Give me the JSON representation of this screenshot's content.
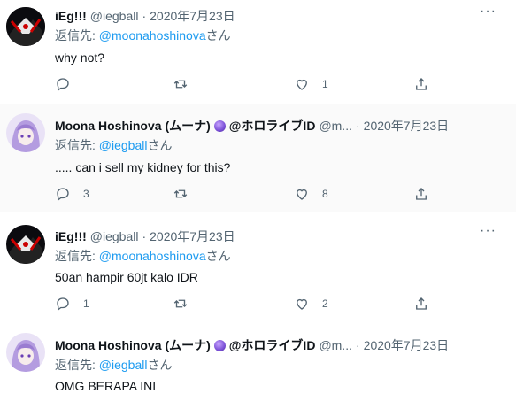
{
  "tweets": [
    {
      "name": "iEg!!!",
      "handle": "@iegball",
      "dot": "·",
      "date": "2020年7月23日",
      "reply_prefix": "返信先: ",
      "reply_to": "@moonahoshinova",
      "reply_suffix": "さん",
      "text": "why not?",
      "reply_count": "",
      "retweet_count": "",
      "like_count": "1"
    },
    {
      "name": "Moona Hoshinova (ムーナ)",
      "name_suffix": "@ホロライブID",
      "handle": "@m...",
      "dot": "·",
      "date": "2020年7月23日",
      "reply_prefix": "返信先: ",
      "reply_to": "@iegball",
      "reply_suffix": "さん",
      "text": "..... can i sell my kidney for this?",
      "reply_count": "3",
      "retweet_count": "",
      "like_count": "8"
    },
    {
      "name": "iEg!!!",
      "handle": "@iegball",
      "dot": "·",
      "date": "2020年7月23日",
      "reply_prefix": "返信先: ",
      "reply_to": "@moonahoshinova",
      "reply_suffix": "さん",
      "text": "50an hampir 60jt kalo IDR",
      "reply_count": "1",
      "retweet_count": "",
      "like_count": "2"
    },
    {
      "name": "Moona Hoshinova (ムーナ)",
      "name_suffix": "@ホロライブID",
      "handle": "@m...",
      "dot": "·",
      "date": "2020年7月23日",
      "reply_prefix": "返信先: ",
      "reply_to": "@iegball",
      "reply_suffix": "さん",
      "text": "OMG BERAPA INI"
    }
  ],
  "more_label": "···",
  "colors": {
    "link": "#1d9bf0",
    "muted": "#536471",
    "badge": "#7a4fd6"
  }
}
